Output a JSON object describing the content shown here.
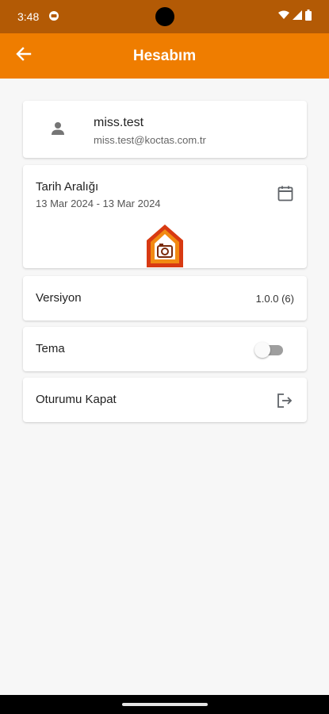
{
  "status_bar": {
    "time": "3:48",
    "icons": [
      "notification-icon",
      "wifi-icon",
      "signal-icon",
      "battery-icon"
    ]
  },
  "app_bar": {
    "title": "Hesabım",
    "back_icon": "arrow-left-icon",
    "background": "#ef7d00"
  },
  "profile": {
    "name": "miss.test",
    "email": "miss.test@koctas.com.tr",
    "icon": "person-icon"
  },
  "date_range": {
    "label": "Tarih Aralığı",
    "value": "13 Mar 2024 - 13 Mar 2024",
    "icon": "calendar-icon"
  },
  "version": {
    "label": "Versiyon",
    "value": "1.0.0 (6)"
  },
  "theme": {
    "label": "Tema",
    "toggle_on": false
  },
  "logout": {
    "label": "Oturumu Kapat",
    "icon": "logout-icon"
  },
  "colors": {
    "status_bar": "#b35a05",
    "accent": "#ef7d00",
    "background": "#f7f7f7"
  }
}
